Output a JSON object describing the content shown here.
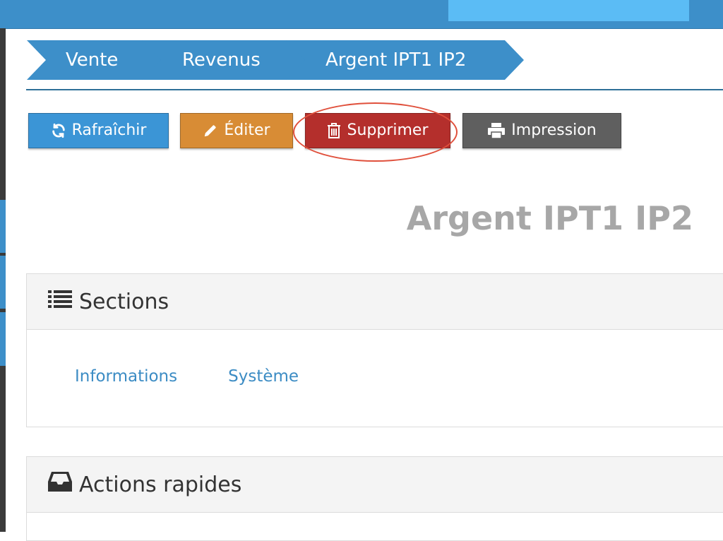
{
  "breadcrumb": {
    "items": [
      {
        "label": "Vente"
      },
      {
        "label": "Revenus"
      },
      {
        "label": "Argent IPT1 IP2"
      }
    ]
  },
  "toolbar": {
    "refresh_label": "Rafraîchir",
    "edit_label": "Éditer",
    "delete_label": "Supprimer",
    "print_label": "Impression"
  },
  "page": {
    "title": "Argent IPT1 IP2"
  },
  "sections_panel": {
    "title": "Sections",
    "links": [
      "Informations",
      "Système"
    ]
  },
  "quick_actions_panel": {
    "title": "Actions rapides"
  },
  "icons": {
    "refresh": "refresh-icon",
    "edit": "pencil-icon",
    "delete": "trash-icon",
    "print": "printer-icon",
    "sections": "list-icon",
    "quick_actions": "inbox-icon"
  },
  "colors": {
    "primary": "#3d8fc9",
    "refresh_button": "#3b95d6",
    "edit_button": "#d88c35",
    "delete_button": "#b42f2c",
    "print_button": "#5f5f5f",
    "highlight_ellipse": "#e0503c",
    "title_gray": "#a7a7a7",
    "link_blue": "#3c8cc4"
  }
}
